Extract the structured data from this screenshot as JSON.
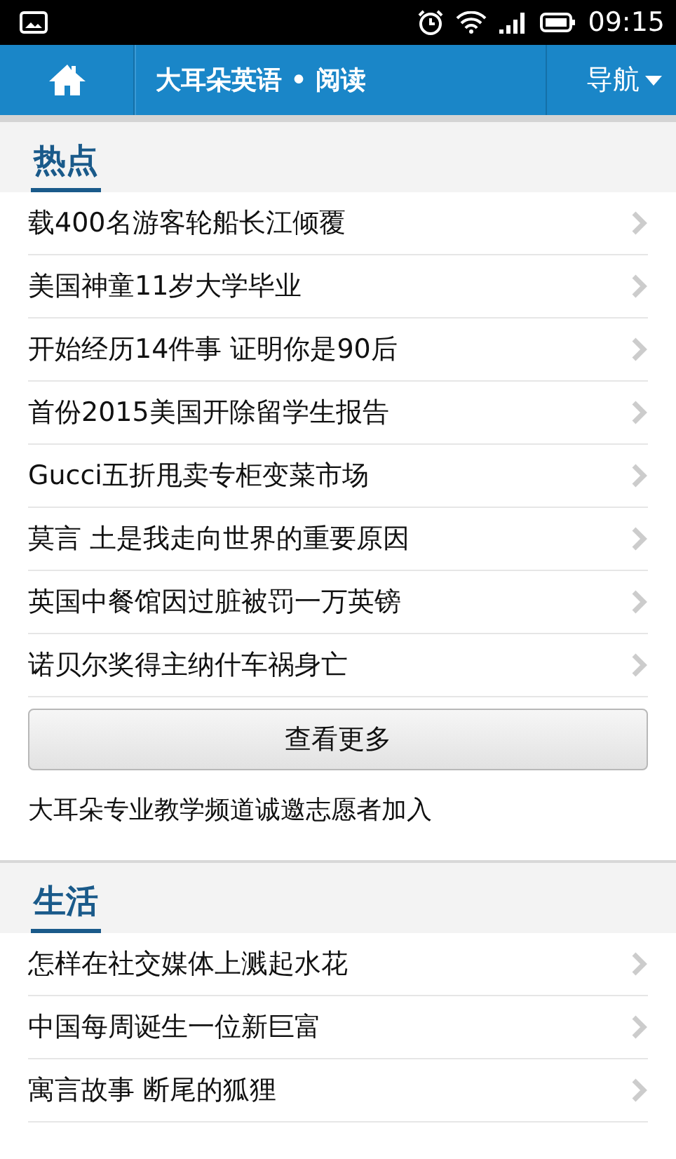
{
  "status_bar": {
    "time": "09:15"
  },
  "app_bar": {
    "title": "大耳朵英语 • 阅读",
    "nav": "导航"
  },
  "sections": [
    {
      "title": "热点",
      "items": [
        {
          "text": "载400名游客轮船长江倾覆"
        },
        {
          "text": "美国神童11岁大学毕业"
        },
        {
          "text": "开始经历14件事 证明你是90后"
        },
        {
          "text": "首份2015美国开除留学生报告"
        },
        {
          "text": "Gucci五折甩卖专柜变菜市场"
        },
        {
          "text": "莫言 土是我走向世界的重要原因"
        },
        {
          "text": "英国中餐馆因过脏被罚一万英镑"
        },
        {
          "text": "诺贝尔奖得主纳什车祸身亡"
        }
      ],
      "more_button": "查看更多",
      "notice": "大耳朵专业教学频道诚邀志愿者加入"
    },
    {
      "title": "生活",
      "items": [
        {
          "text": "怎样在社交媒体上溅起水花"
        },
        {
          "text": "中国每周诞生一位新巨富"
        },
        {
          "text": "寓言故事 断尾的狐狸"
        }
      ]
    }
  ]
}
